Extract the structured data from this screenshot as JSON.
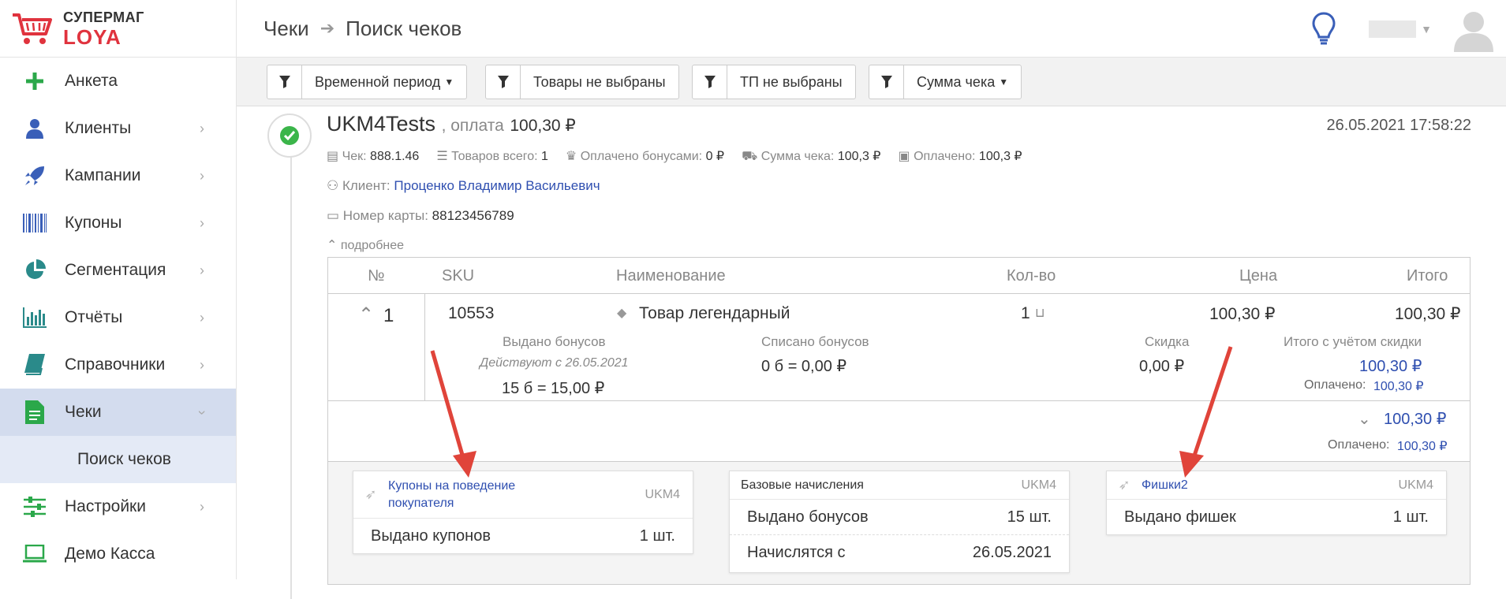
{
  "brand": {
    "line1": "СУПЕРМАГ",
    "line2": "LOYA",
    "accent": "#e0333e"
  },
  "sidebar": {
    "items": [
      {
        "label": "Анкета",
        "icon": "plus-icon",
        "chevron": false
      },
      {
        "label": "Клиенты",
        "icon": "user-icon",
        "chevron": true
      },
      {
        "label": "Кампании",
        "icon": "rocket-icon",
        "chevron": true
      },
      {
        "label": "Купоны",
        "icon": "barcode-icon",
        "chevron": true
      },
      {
        "label": "Сегментация",
        "icon": "pie-chart-icon",
        "chevron": true
      },
      {
        "label": "Отчёты",
        "icon": "bar-chart-icon",
        "chevron": true
      },
      {
        "label": "Справочники",
        "icon": "book-icon",
        "chevron": true
      },
      {
        "label": "Чеки",
        "icon": "document-icon",
        "chevron": true,
        "active": true
      },
      {
        "label": "Настройки",
        "icon": "sliders-icon",
        "chevron": true
      },
      {
        "label": "Демо Касса",
        "icon": "laptop-icon",
        "chevron": false
      }
    ],
    "sub_item": "Поиск чеков"
  },
  "header": {
    "crumb1": "Чеки",
    "crumb2": "Поиск чеков"
  },
  "filters": {
    "period": "Временной период",
    "goods": "Товары не выбраны",
    "tp": "ТП не выбраны",
    "sum": "Сумма чека"
  },
  "receipt": {
    "store": "UKM4Tests",
    "pay_label": ", оплата",
    "pay_amount": "100,30 ₽",
    "date": "26.05.2021 17:58:22",
    "check_label": "Чек:",
    "check_value": "888.1.46",
    "goods_label": "Товаров всего:",
    "goods_value": "1",
    "bonus_label": "Оплачено бонусами:",
    "bonus_value": "0 ₽",
    "sum_label": "Сумма чека:",
    "sum_value": "100,3 ₽",
    "paid_label": "Оплачено:",
    "paid_value": "100,3 ₽",
    "client_label": "Клиент:",
    "client_name": "Проценко Владимир Васильевич",
    "card_label": "Номер карты:",
    "card_value": "88123456789",
    "more_label": "подробнее"
  },
  "table": {
    "headers": {
      "num": "№",
      "sku": "SKU",
      "name": "Наименование",
      "qty": "Кол-во",
      "price": "Цена",
      "total": "Итого"
    },
    "row": {
      "num": "1",
      "sku": "10553",
      "name": "Товар легендарный",
      "qty": "1",
      "price": "100,30 ₽",
      "total": "100,30 ₽",
      "issued_label": "Выдано бонусов",
      "issued_since": "Действуют с 26.05.2021",
      "issued_value": "15 б = 15,00 ₽",
      "written_label": "Списано бонусов",
      "written_value": "0 б = 0,00 ₽",
      "discount_label": "Скидка",
      "discount_value": "0,00 ₽",
      "total_disc_label": "Итого с учётом скидки",
      "total_disc_value": "100,30 ₽",
      "paid_label": "Оплачено:",
      "paid_value": "100,30 ₽"
    },
    "footer": {
      "total": "100,30 ₽",
      "paid_label": "Оплачено:",
      "paid_value": "100,30 ₽"
    }
  },
  "cards": [
    {
      "title": "Купоны на поведение покупателя",
      "tag": "UKM4",
      "rows": [
        {
          "label": "Выдано купонов",
          "value": "1 шт."
        }
      ]
    },
    {
      "title": "Базовые начисления",
      "tag": "UKM4",
      "rows": [
        {
          "label": "Выдано бонусов",
          "value": "15 шт."
        },
        {
          "label": "Начислятся с",
          "value": "26.05.2021"
        }
      ]
    },
    {
      "title": "Фишки2",
      "tag": "UKM4",
      "rows": [
        {
          "label": "Выдано фишек",
          "value": "1 шт."
        }
      ]
    }
  ]
}
